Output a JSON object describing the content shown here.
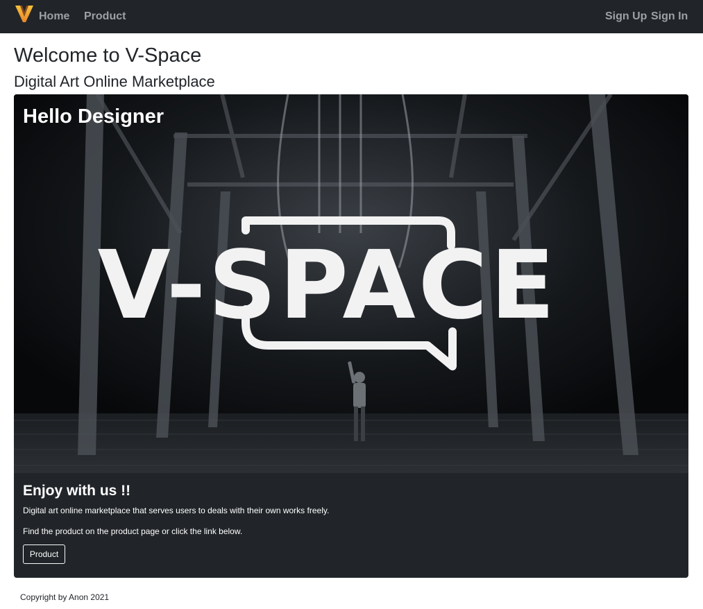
{
  "nav": {
    "brand_icon": "v-logo-icon",
    "links": [
      "Home",
      "Product"
    ],
    "auth_links": [
      "Sign Up",
      "Sign In"
    ]
  },
  "page": {
    "title": "Welcome to V-Space",
    "subtitle": "Digital Art Online Marketplace"
  },
  "card": {
    "hero_title": "Hello Designer",
    "hero_logo_text": "V-SPACE",
    "title": "Enjoy with us !!",
    "text1": "Digital art online marketplace that serves users to deals with their own works freely.",
    "text2": "Find the product on the product page or click the link below.",
    "button_label": "Product"
  },
  "footer": {
    "text": "Copyright by Anon 2021"
  },
  "colors": {
    "navbar_bg": "#212529",
    "nav_link": "#9da0a4",
    "brand_primary": "#f5a623"
  }
}
